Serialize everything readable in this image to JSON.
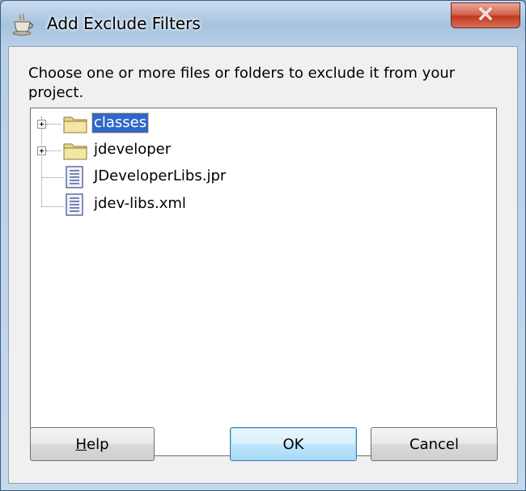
{
  "window": {
    "title": "Add Exclude Filters",
    "close_label": "X",
    "icon": "java-cup-icon"
  },
  "dialog": {
    "prompt": "Choose one or more files or folders to exclude it from your project."
  },
  "tree": {
    "items": [
      {
        "label": "classes",
        "type": "folder",
        "expandable": true,
        "selected": true
      },
      {
        "label": "jdeveloper",
        "type": "folder",
        "expandable": true,
        "selected": false
      },
      {
        "label": "JDeveloperLibs.jpr",
        "type": "file",
        "expandable": false,
        "selected": false
      },
      {
        "label": "jdev-libs.xml",
        "type": "file",
        "expandable": false,
        "selected": false
      }
    ]
  },
  "buttons": {
    "help_mnemonic": "H",
    "help_rest": "elp",
    "ok": "OK",
    "cancel": "Cancel"
  },
  "colors": {
    "selection": "#3068c8",
    "close_button": "#c0391f",
    "default_button": "#3c7fb1"
  }
}
